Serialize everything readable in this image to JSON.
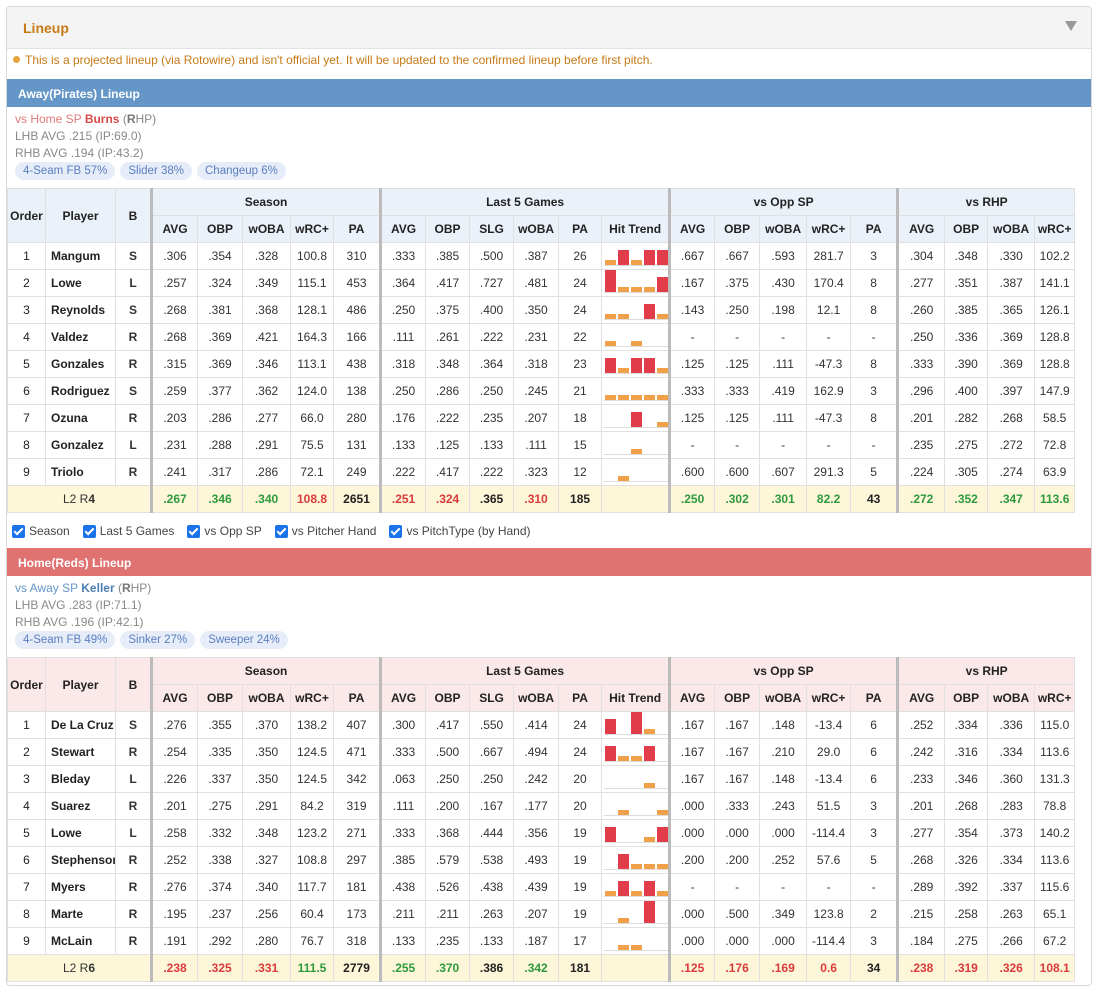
{
  "header": {
    "title": "Lineup"
  },
  "notice": "This is a projected lineup (via Rotowire) and isn't official yet. It will be updated to the confirmed lineup before first pitch.",
  "checks": [
    "Season",
    "Last 5 Games",
    "vs Opp SP",
    "vs Pitcher Hand",
    "vs PitchType (by Hand)"
  ],
  "colors": {
    "away_bar": "#6497c8",
    "home_bar": "#e07272",
    "good": "#2e9a3e",
    "bad": "#d93b3b",
    "hit_high": "#e03c4a",
    "hit_low": "#f0a048"
  },
  "groups": [
    "Season",
    "Last 5 Games",
    "vs Opp SP",
    "vs RHP"
  ],
  "columns": {
    "order": "Order",
    "player": "Player",
    "b": "B",
    "season": [
      "AVG",
      "OBP",
      "wOBA",
      "wRC+",
      "PA"
    ],
    "last5": [
      "AVG",
      "OBP",
      "SLG",
      "wOBA",
      "PA",
      "Hit Trend"
    ],
    "opp": [
      "AVG",
      "OBP",
      "wOBA",
      "wRC+",
      "PA"
    ],
    "hand": [
      "AVG",
      "OBP",
      "wOBA",
      "wRC+"
    ]
  },
  "away": {
    "bar": "Away(Pirates) Lineup",
    "sp": {
      "vs": "vs Home SP ",
      "name": "Burns",
      "hand_pre": " (",
      "hand_b": "R",
      "hand_post": "HP)",
      "lhb": "LHB AVG .215 (IP:69.0)",
      "rhb": "RHB AVG .194 (IP:43.2)"
    },
    "pills": [
      "4-Seam FB 57%",
      "Slider 38%",
      "Changeup 6%"
    ],
    "rows": [
      {
        "o": "1",
        "p": "Mangum",
        "b": "S",
        "s": [
          ".306",
          ".354",
          ".328",
          "100.8",
          "310"
        ],
        "l": [
          ".333",
          ".385",
          ".500",
          ".387",
          "26"
        ],
        "t": [
          1,
          2,
          1,
          2,
          2
        ],
        "op": [
          ".667",
          ".667",
          ".593",
          "281.7",
          "3"
        ],
        "h": [
          ".304",
          ".348",
          ".330",
          "102.2"
        ]
      },
      {
        "o": "2",
        "p": "Lowe",
        "b": "L",
        "s": [
          ".257",
          ".324",
          ".349",
          "115.1",
          "453"
        ],
        "l": [
          ".364",
          ".417",
          ".727",
          ".481",
          "24"
        ],
        "t": [
          3,
          1,
          1,
          1,
          2
        ],
        "op": [
          ".167",
          ".375",
          ".430",
          "170.4",
          "8"
        ],
        "h": [
          ".277",
          ".351",
          ".387",
          "141.1"
        ]
      },
      {
        "o": "3",
        "p": "Reynolds",
        "b": "S",
        "s": [
          ".268",
          ".381",
          ".368",
          "128.1",
          "486"
        ],
        "l": [
          ".250",
          ".375",
          ".400",
          ".350",
          "24"
        ],
        "t": [
          1,
          1,
          0,
          2,
          1
        ],
        "op": [
          ".143",
          ".250",
          ".198",
          "12.1",
          "8"
        ],
        "h": [
          ".260",
          ".385",
          ".365",
          "126.1"
        ]
      },
      {
        "o": "4",
        "p": "Valdez",
        "b": "R",
        "s": [
          ".268",
          ".369",
          ".421",
          "164.3",
          "166"
        ],
        "l": [
          ".111",
          ".261",
          ".222",
          ".231",
          "22"
        ],
        "t": [
          1,
          0,
          1,
          0,
          0
        ],
        "op": [
          "-",
          "-",
          "-",
          "-",
          "-"
        ],
        "h": [
          ".250",
          ".336",
          ".369",
          "128.8"
        ]
      },
      {
        "o": "5",
        "p": "Gonzales",
        "b": "R",
        "s": [
          ".315",
          ".369",
          ".346",
          "113.1",
          "438"
        ],
        "l": [
          ".318",
          ".348",
          ".364",
          ".318",
          "23"
        ],
        "t": [
          2,
          1,
          2,
          2,
          1
        ],
        "op": [
          ".125",
          ".125",
          ".111",
          "-47.3",
          "8"
        ],
        "h": [
          ".333",
          ".390",
          ".369",
          "128.8"
        ]
      },
      {
        "o": "6",
        "p": "Rodriguez",
        "b": "S",
        "s": [
          ".259",
          ".377",
          ".362",
          "124.0",
          "138"
        ],
        "l": [
          ".250",
          ".286",
          ".250",
          ".245",
          "21"
        ],
        "t": [
          1,
          1,
          1,
          1,
          1
        ],
        "op": [
          ".333",
          ".333",
          ".419",
          "162.9",
          "3"
        ],
        "h": [
          ".296",
          ".400",
          ".397",
          "147.9"
        ]
      },
      {
        "o": "7",
        "p": "Ozuna",
        "b": "R",
        "s": [
          ".203",
          ".286",
          ".277",
          "66.0",
          "280"
        ],
        "l": [
          ".176",
          ".222",
          ".235",
          ".207",
          "18"
        ],
        "t": [
          0,
          0,
          2,
          0,
          1
        ],
        "op": [
          ".125",
          ".125",
          ".111",
          "-47.3",
          "8"
        ],
        "h": [
          ".201",
          ".282",
          ".268",
          "58.5"
        ]
      },
      {
        "o": "8",
        "p": "Gonzalez",
        "b": "L",
        "s": [
          ".231",
          ".288",
          ".291",
          "75.5",
          "131"
        ],
        "l": [
          ".133",
          ".125",
          ".133",
          ".111",
          "15"
        ],
        "t": [
          0,
          0,
          1,
          0,
          0
        ],
        "op": [
          "-",
          "-",
          "-",
          "-",
          "-"
        ],
        "h": [
          ".235",
          ".275",
          ".272",
          "72.8"
        ]
      },
      {
        "o": "9",
        "p": "Triolo",
        "b": "R",
        "s": [
          ".241",
          ".317",
          ".286",
          "72.1",
          "249"
        ],
        "l": [
          ".222",
          ".417",
          ".222",
          ".323",
          "12"
        ],
        "t": [
          0,
          1,
          0,
          0,
          0
        ],
        "op": [
          ".600",
          ".600",
          ".607",
          "291.3",
          "5"
        ],
        "h": [
          ".224",
          ".305",
          ".274",
          "63.9"
        ]
      }
    ],
    "total": {
      "label_pre": "L2 R",
      "label_b": "4",
      "s": [
        ".267",
        ".346",
        ".340",
        "108.8",
        "2651"
      ],
      "l": [
        ".251",
        ".324",
        ".365",
        ".310",
        "185"
      ],
      "op": [
        ".250",
        ".302",
        ".301",
        "82.2",
        "43"
      ],
      "h": [
        ".272",
        ".352",
        ".347",
        "113.6"
      ]
    }
  },
  "home": {
    "bar": "Home(Reds) Lineup",
    "sp": {
      "vs": "vs Away SP ",
      "name": "Keller",
      "hand_pre": " (",
      "hand_b": "R",
      "hand_post": "HP)",
      "lhb": "LHB AVG .283 (IP:71.1)",
      "rhb": "RHB AVG .196 (IP:42.1)"
    },
    "pills": [
      "4-Seam FB 49%",
      "Sinker 27%",
      "Sweeper 24%"
    ],
    "rows": [
      {
        "o": "1",
        "p": "De La Cruz",
        "b": "S",
        "s": [
          ".276",
          ".355",
          ".370",
          "138.2",
          "407"
        ],
        "l": [
          ".300",
          ".417",
          ".550",
          ".414",
          "24"
        ],
        "t": [
          2,
          0,
          3,
          1,
          0
        ],
        "op": [
          ".167",
          ".167",
          ".148",
          "-13.4",
          "6"
        ],
        "h": [
          ".252",
          ".334",
          ".336",
          "115.0"
        ]
      },
      {
        "o": "2",
        "p": "Stewart",
        "b": "R",
        "s": [
          ".254",
          ".335",
          ".350",
          "124.5",
          "471"
        ],
        "l": [
          ".333",
          ".500",
          ".667",
          ".494",
          "24"
        ],
        "t": [
          2,
          1,
          1,
          2,
          0
        ],
        "op": [
          ".167",
          ".167",
          ".210",
          "29.0",
          "6"
        ],
        "h": [
          ".242",
          ".316",
          ".334",
          "113.6"
        ]
      },
      {
        "o": "3",
        "p": "Bleday",
        "b": "L",
        "s": [
          ".226",
          ".337",
          ".350",
          "124.5",
          "342"
        ],
        "l": [
          ".063",
          ".250",
          ".250",
          ".242",
          "20"
        ],
        "t": [
          0,
          0,
          0,
          1,
          0
        ],
        "op": [
          ".167",
          ".167",
          ".148",
          "-13.4",
          "6"
        ],
        "h": [
          ".233",
          ".346",
          ".360",
          "131.3"
        ]
      },
      {
        "o": "4",
        "p": "Suarez",
        "b": "R",
        "s": [
          ".201",
          ".275",
          ".291",
          "84.2",
          "319"
        ],
        "l": [
          ".111",
          ".200",
          ".167",
          ".177",
          "20"
        ],
        "t": [
          0,
          1,
          0,
          0,
          1
        ],
        "op": [
          ".000",
          ".333",
          ".243",
          "51.5",
          "3"
        ],
        "h": [
          ".201",
          ".268",
          ".283",
          "78.8"
        ]
      },
      {
        "o": "5",
        "p": "Lowe",
        "b": "L",
        "s": [
          ".258",
          ".332",
          ".348",
          "123.2",
          "271"
        ],
        "l": [
          ".333",
          ".368",
          ".444",
          ".356",
          "19"
        ],
        "t": [
          2,
          0,
          0,
          1,
          2
        ],
        "op": [
          ".000",
          ".000",
          ".000",
          "-114.4",
          "3"
        ],
        "h": [
          ".277",
          ".354",
          ".373",
          "140.2"
        ]
      },
      {
        "o": "6",
        "p": "Stephenson",
        "b": "R",
        "s": [
          ".252",
          ".338",
          ".327",
          "108.8",
          "297"
        ],
        "l": [
          ".385",
          ".579",
          ".538",
          ".493",
          "19"
        ],
        "t": [
          0,
          2,
          1,
          1,
          1
        ],
        "op": [
          ".200",
          ".200",
          ".252",
          "57.6",
          "5"
        ],
        "h": [
          ".268",
          ".326",
          ".334",
          "113.6"
        ]
      },
      {
        "o": "7",
        "p": "Myers",
        "b": "R",
        "s": [
          ".276",
          ".374",
          ".340",
          "117.7",
          "181"
        ],
        "l": [
          ".438",
          ".526",
          ".438",
          ".439",
          "19"
        ],
        "t": [
          1,
          2,
          1,
          2,
          1
        ],
        "op": [
          "-",
          "-",
          "-",
          "-",
          "-"
        ],
        "h": [
          ".289",
          ".392",
          ".337",
          "115.6"
        ]
      },
      {
        "o": "8",
        "p": "Marte",
        "b": "R",
        "s": [
          ".195",
          ".237",
          ".256",
          "60.4",
          "173"
        ],
        "l": [
          ".211",
          ".211",
          ".263",
          ".207",
          "19"
        ],
        "t": [
          0,
          1,
          0,
          3,
          0
        ],
        "op": [
          ".000",
          ".500",
          ".349",
          "123.8",
          "2"
        ],
        "h": [
          ".215",
          ".258",
          ".263",
          "65.1"
        ]
      },
      {
        "o": "9",
        "p": "McLain",
        "b": "R",
        "s": [
          ".191",
          ".292",
          ".280",
          "76.7",
          "318"
        ],
        "l": [
          ".133",
          ".235",
          ".133",
          ".187",
          "17"
        ],
        "t": [
          0,
          1,
          1,
          0,
          0
        ],
        "op": [
          ".000",
          ".000",
          ".000",
          "-114.4",
          "3"
        ],
        "h": [
          ".184",
          ".275",
          ".266",
          "67.2"
        ]
      }
    ],
    "total": {
      "label_pre": "L2 R",
      "label_b": "6",
      "s": [
        ".238",
        ".325",
        ".331",
        "111.5",
        "2779"
      ],
      "l": [
        ".255",
        ".370",
        ".386",
        ".342",
        "181"
      ],
      "op": [
        ".125",
        ".176",
        ".169",
        "0.6",
        "34"
      ],
      "h": [
        ".238",
        ".319",
        ".326",
        "108.1"
      ]
    }
  },
  "total_colors": {
    "away": {
      "s": [
        "g",
        "g",
        "g",
        "r",
        "k"
      ],
      "l": [
        "r",
        "r",
        "k",
        "r",
        "k"
      ],
      "op": [
        "g",
        "g",
        "g",
        "g",
        "k"
      ],
      "h": [
        "g",
        "g",
        "g",
        "g"
      ]
    },
    "home": {
      "s": [
        "r",
        "r",
        "r",
        "g",
        "k"
      ],
      "l": [
        "g",
        "g",
        "k",
        "g",
        "k"
      ],
      "op": [
        "r",
        "r",
        "r",
        "r",
        "k"
      ],
      "h": [
        "r",
        "r",
        "r",
        "r"
      ]
    }
  }
}
